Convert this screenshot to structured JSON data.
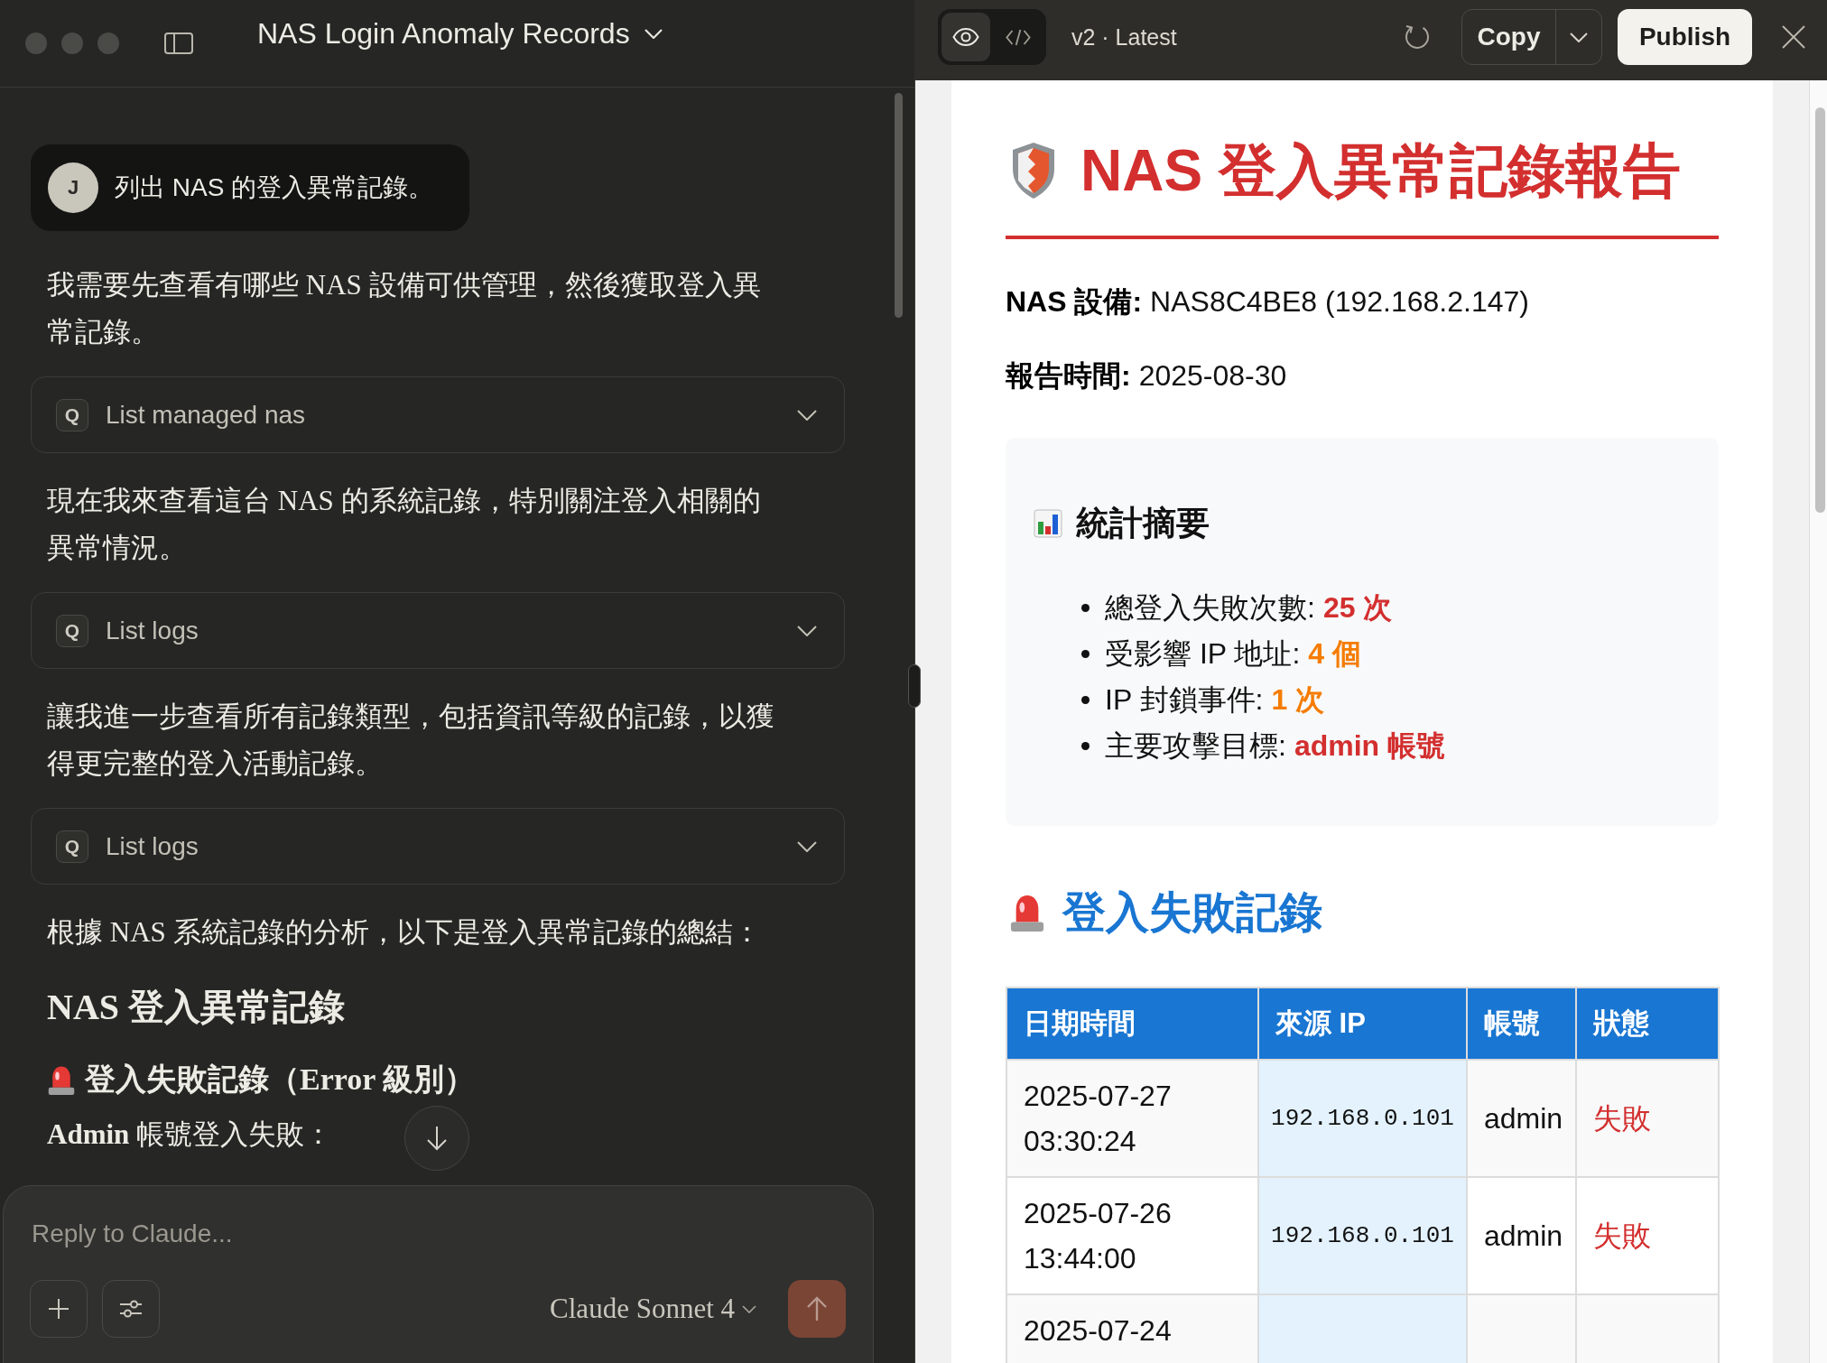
{
  "chat": {
    "title": "NAS Login Anomaly Records",
    "user_message": {
      "initial": "J",
      "text": "列出 NAS 的登入異常記錄。"
    },
    "messages": [
      {
        "kind": "paragraph",
        "text": "我需要先查看有哪些 NAS 設備可供管理，然後獲取登入異常記錄。"
      },
      {
        "kind": "tool",
        "icon": "Q",
        "label": "List managed nas",
        "expanded": false
      },
      {
        "kind": "paragraph",
        "text": "現在我來查看這台 NAS 的系統記錄，特別關注登入相關的異常情況。"
      },
      {
        "kind": "tool",
        "icon": "Q",
        "label": "List logs",
        "expanded": false
      },
      {
        "kind": "paragraph",
        "text": "讓我進一步查看所有記錄類型，包括資訊等級的記錄，以獲得更完整的登入活動記錄。"
      },
      {
        "kind": "tool",
        "icon": "Q",
        "label": "List logs",
        "expanded": false
      },
      {
        "kind": "paragraph",
        "text": "根據 NAS 系統記錄的分析，以下是登入異常記錄的總結："
      },
      {
        "kind": "heading",
        "text": "NAS 登入異常記錄"
      },
      {
        "kind": "subheading",
        "text": "登入失敗記錄（Error 級別）"
      },
      {
        "kind": "paragraph",
        "text": "**Admin** 帳號登入失敗："
      }
    ],
    "composer": {
      "placeholder": "Reply to Claude...",
      "model": "Claude Sonnet 4"
    }
  },
  "artifact": {
    "view_modes": [
      {
        "kind": "preview",
        "selected": true
      },
      {
        "kind": "code",
        "selected": false
      }
    ],
    "version": "v2 · Latest",
    "copy_label": "Copy",
    "publish_label": "Publish",
    "report": {
      "title": "NAS 登入異常記錄報告",
      "meta": [
        {
          "label": "NAS 設備:",
          "value": "NAS8C4BE8 (192.168.2.147)"
        },
        {
          "label": "報告時間:",
          "value": "2025-08-30"
        }
      ],
      "summary": {
        "title": "統計摘要",
        "items": [
          {
            "label": "總登入失敗次數:",
            "value": "25 次",
            "color": "#d32f2f"
          },
          {
            "label": "受影響 IP 地址:",
            "value": "4 個",
            "color": "#f57c00"
          },
          {
            "label": "IP 封鎖事件:",
            "value": "1 次",
            "color": "#f57c00"
          },
          {
            "label": "主要攻擊目標:",
            "value": "admin 帳號",
            "color": "#d32f2f"
          }
        ]
      },
      "failed_logins": {
        "title": "登入失敗記錄",
        "columns": [
          "日期時間",
          "來源 IP",
          "帳號",
          "狀態"
        ],
        "rows": [
          {
            "datetime": "2025-07-27 03:30:24",
            "source_ip": "192.168.0.101",
            "account": "admin",
            "status": "失敗"
          },
          {
            "datetime": "2025-07-26 13:44:00",
            "source_ip": "192.168.0.101",
            "account": "admin",
            "status": "失敗"
          },
          {
            "datetime": "2025-07-24"
          }
        ]
      }
    }
  }
}
